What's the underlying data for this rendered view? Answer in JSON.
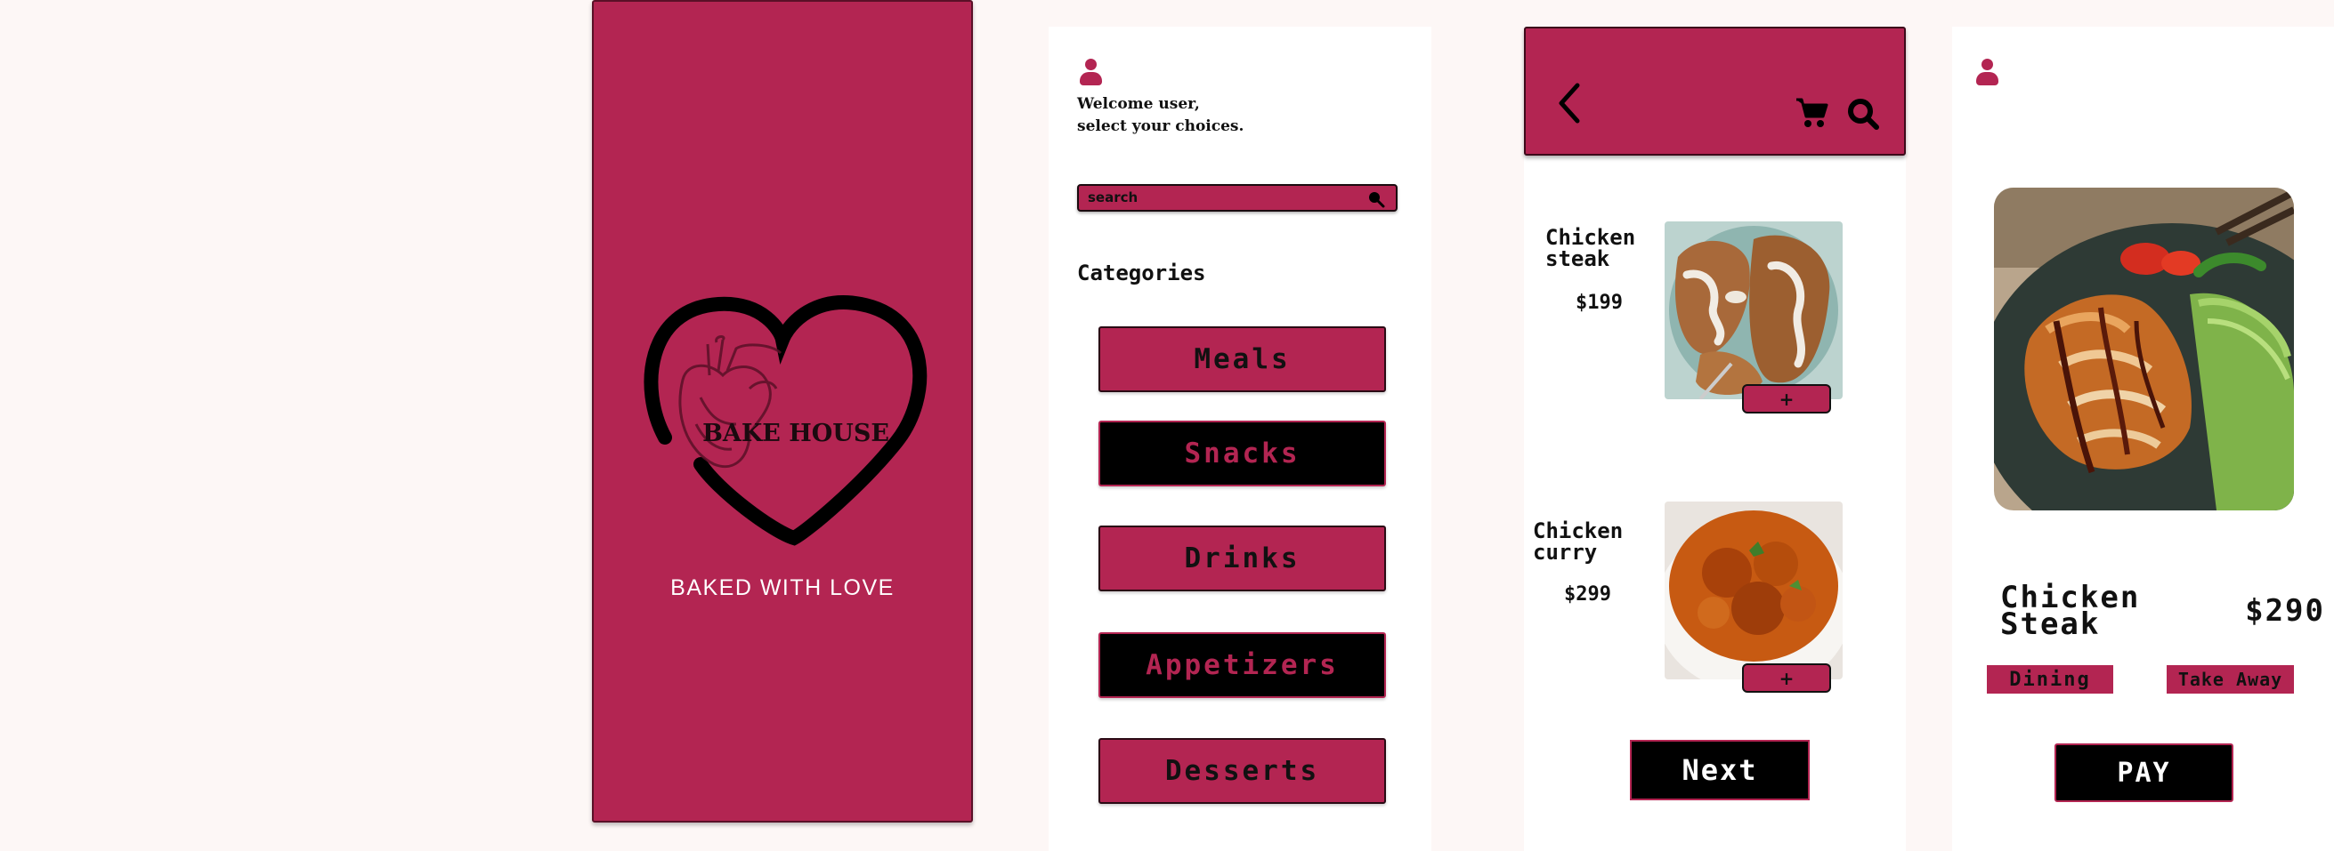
{
  "splash": {
    "brand": "BAKE HOUSE",
    "tagline": "BAKED WITH LOVE",
    "logo_icon": "anatomical-heart-in-heart-outline"
  },
  "categories_screen": {
    "welcome_line1": "Welcome user,",
    "welcome_line2": "select your choices.",
    "search": {
      "placeholder": "search"
    },
    "title": "Categories",
    "items": [
      {
        "label": "Meals",
        "style": "pink"
      },
      {
        "label": "Snacks",
        "style": "black"
      },
      {
        "label": "Drinks",
        "style": "pink"
      },
      {
        "label": "Appetizers",
        "style": "black"
      },
      {
        "label": "Desserts",
        "style": "pink"
      }
    ]
  },
  "list_screen": {
    "products": [
      {
        "name": "Chicken steak",
        "price": "$199",
        "add_label": "+",
        "image": "fried-chicken-steak"
      },
      {
        "name": "Chicken curry",
        "price": "$299",
        "add_label": "+",
        "image": "chicken-curry-bowl"
      }
    ],
    "next_label": "Next"
  },
  "detail_screen": {
    "name": "Chicken Steak",
    "price": "$290",
    "dining_label": "Dining",
    "takeaway_label": "Take Away",
    "pay_label": "PAY"
  },
  "colors": {
    "accent": "#b32552",
    "background": "#fdf7f6",
    "dark": "#000000"
  }
}
